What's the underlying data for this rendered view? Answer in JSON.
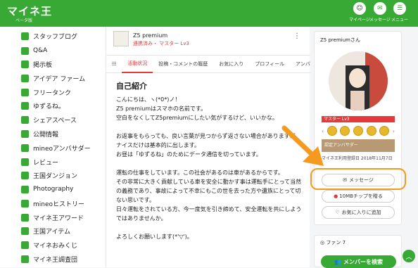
{
  "header": {
    "logo": "マイネ王",
    "logo_sub": "ベータ版",
    "nav": [
      {
        "label": "マイページ",
        "icon": "avatar-icon"
      },
      {
        "label": "メッセージ",
        "icon": "mail-icon"
      },
      {
        "label": "メニュー",
        "icon": "menu-icon"
      }
    ]
  },
  "sidebar": {
    "items": [
      {
        "label": "スタッフブログ",
        "icon": "blog-icon"
      },
      {
        "label": "Q&A",
        "icon": "qa-icon"
      },
      {
        "label": "掲示板",
        "icon": "board-icon"
      },
      {
        "label": "アイデア ファーム",
        "icon": "idea-icon"
      },
      {
        "label": "フリータンク",
        "icon": "tank-icon"
      },
      {
        "label": "ゆずるね。",
        "icon": "yuzurune-icon"
      },
      {
        "label": "シェアスペース",
        "icon": "share-icon"
      },
      {
        "label": "公開情報",
        "icon": "info-icon"
      },
      {
        "label": "mineoアンバサダー",
        "icon": "ambassador-icon"
      },
      {
        "label": "レビュー",
        "icon": "review-icon"
      },
      {
        "label": "王国ダンジョン",
        "icon": "dungeon-icon"
      },
      {
        "label": "Photography",
        "icon": "camera-icon"
      },
      {
        "label": "mineoヒストリー",
        "icon": "history-icon"
      },
      {
        "label": "マイネ王アワード",
        "icon": "award-icon"
      },
      {
        "label": "王国アイテム",
        "icon": "item-icon"
      },
      {
        "label": "マイネおみくじ",
        "icon": "omikuji-icon"
      },
      {
        "label": "マイネ王調査団",
        "icon": "survey-icon"
      }
    ]
  },
  "profile": {
    "name": "Z5 premium",
    "status": "連携済み・ マスター Lv3",
    "tabs": [
      "活動状況",
      "投稿・コメントの履歴",
      "お気に入り",
      "プロフィール",
      "アンバ"
    ],
    "intro_title": "自己紹介",
    "intro_lines": [
      "こんにちは、ヽ(*0*)ノ！",
      "Z5 premiumはスマホの名前です。",
      "空白をなくしてZ5premiumにしたい気がするけど、いいかな。",
      "",
      "お返事をもらっても、良い言葉が見つからず返さない場合がありますが、",
      "ナイスだけは基本的に出します。",
      "お昼は「ゆずるね」のためにデータ通信を切っています。",
      "",
      "運転の仕事をしています。この社会があるのは車があるからです。",
      "その非常に大きく貢献している車を安全に動かす事は運転手にとって当然",
      "の義務であり、事故によって不幸にもこの世を去った方や遺族にとって切",
      "ない思いです。",
      "日々運転をされている方、今一度気を引き締めて、安全運転を共にしよう",
      "ではありませんか。",
      "",
      "よろしくお願いします(*'▽')。"
    ]
  },
  "card": {
    "title": "Z5 premiumさん",
    "level": "マスター Lv3",
    "ambassador": "認定アンバサダー",
    "since": "マイネ王利用登録日 2018年11月7日",
    "message_btn": "メッセージ",
    "chip_btn": "10MBチップを贈る",
    "fav_btn": "お気に入りに追加"
  },
  "fans": {
    "label": "ファン",
    "count": "7",
    "search_btn": "メンバーを検索"
  }
}
